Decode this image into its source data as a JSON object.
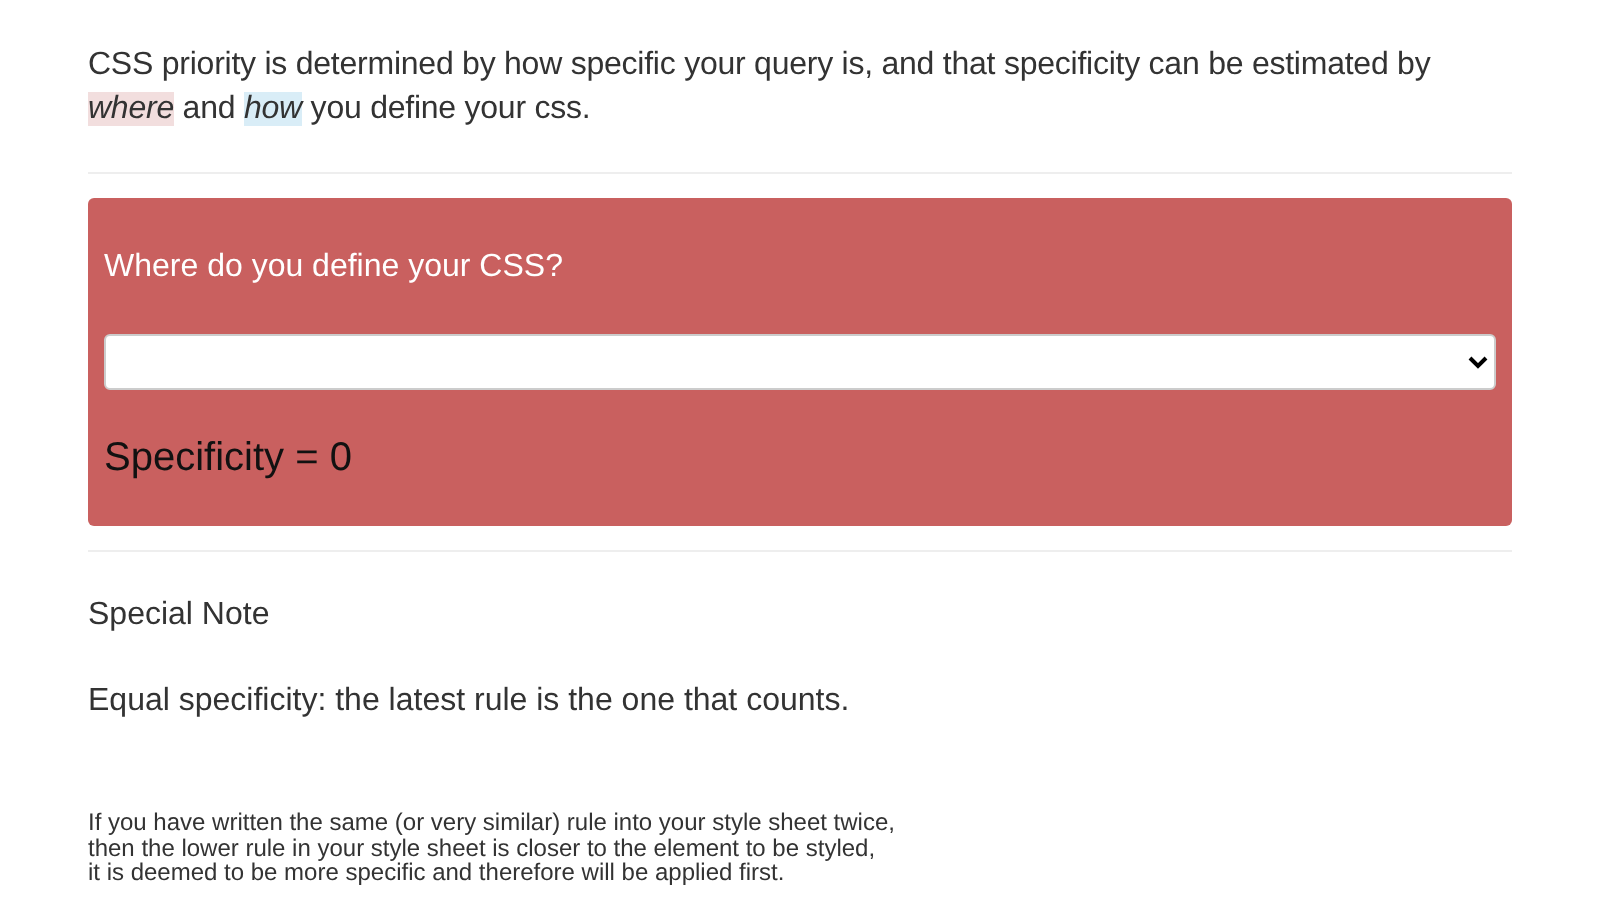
{
  "intro": [
    {
      "text": "CSS priority is determined by how specific your query is, and that specificity can be estimated by "
    },
    {
      "text": "where",
      "color": "#f2dede"
    },
    {
      "text": " and "
    },
    {
      "text": "how",
      "color": "#d9edf7"
    },
    {
      "text": " you define your css."
    }
  ],
  "panel": {
    "question": "Where do you define your CSS?",
    "result": "Specificity = 0"
  },
  "note": {
    "title": "Special Note",
    "rule": "Equal specificity: the latest rule is the one that counts.",
    "details": [
      "If you have written the same (or very similar) rule into your style sheet twice,",
      "then the lower rule in your style sheet is closer to the element to be styled,",
      "it is deemed to be more specific and therefore will be applied first."
    ]
  }
}
